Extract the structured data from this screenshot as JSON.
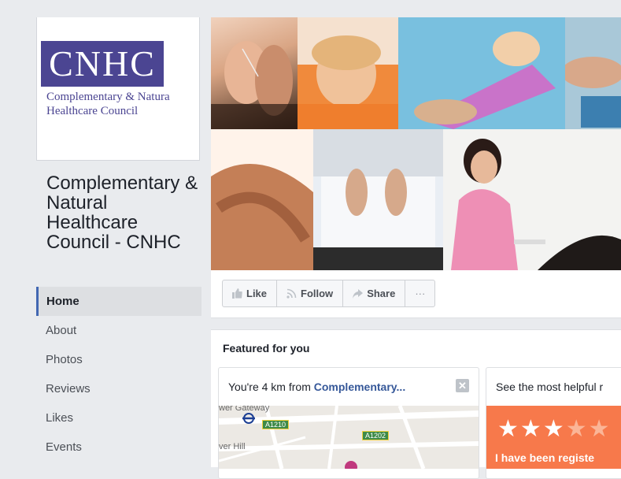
{
  "profile": {
    "logo_text": "CNHC",
    "logo_sub_line1": "Complementary & Natura",
    "logo_sub_line2": "Healthcare Council"
  },
  "page_name": "Complementary & Natural Healthcare Council - CNHC",
  "nav": {
    "items": [
      {
        "label": "Home",
        "active": true
      },
      {
        "label": "About"
      },
      {
        "label": "Photos"
      },
      {
        "label": "Reviews"
      },
      {
        "label": "Likes"
      },
      {
        "label": "Events"
      }
    ]
  },
  "actions": {
    "like": "Like",
    "follow": "Follow",
    "share": "Share",
    "more": "···"
  },
  "featured": {
    "title": "Featured for you",
    "card1": {
      "prefix": "You're 4 km from ",
      "place": "Complementary...",
      "map_labels": {
        "top": "wer Gateway",
        "road1": "A1210",
        "road2": "A1202",
        "left": "ver Hill"
      }
    },
    "card2": {
      "heading": "See the most helpful r",
      "stars_filled": 3,
      "stars_total": 5,
      "review_text": "I have been registe"
    }
  },
  "colors": {
    "brand_purple": "#4b4592",
    "facebook_blue": "#4267b2",
    "review_orange": "#f7794b"
  }
}
